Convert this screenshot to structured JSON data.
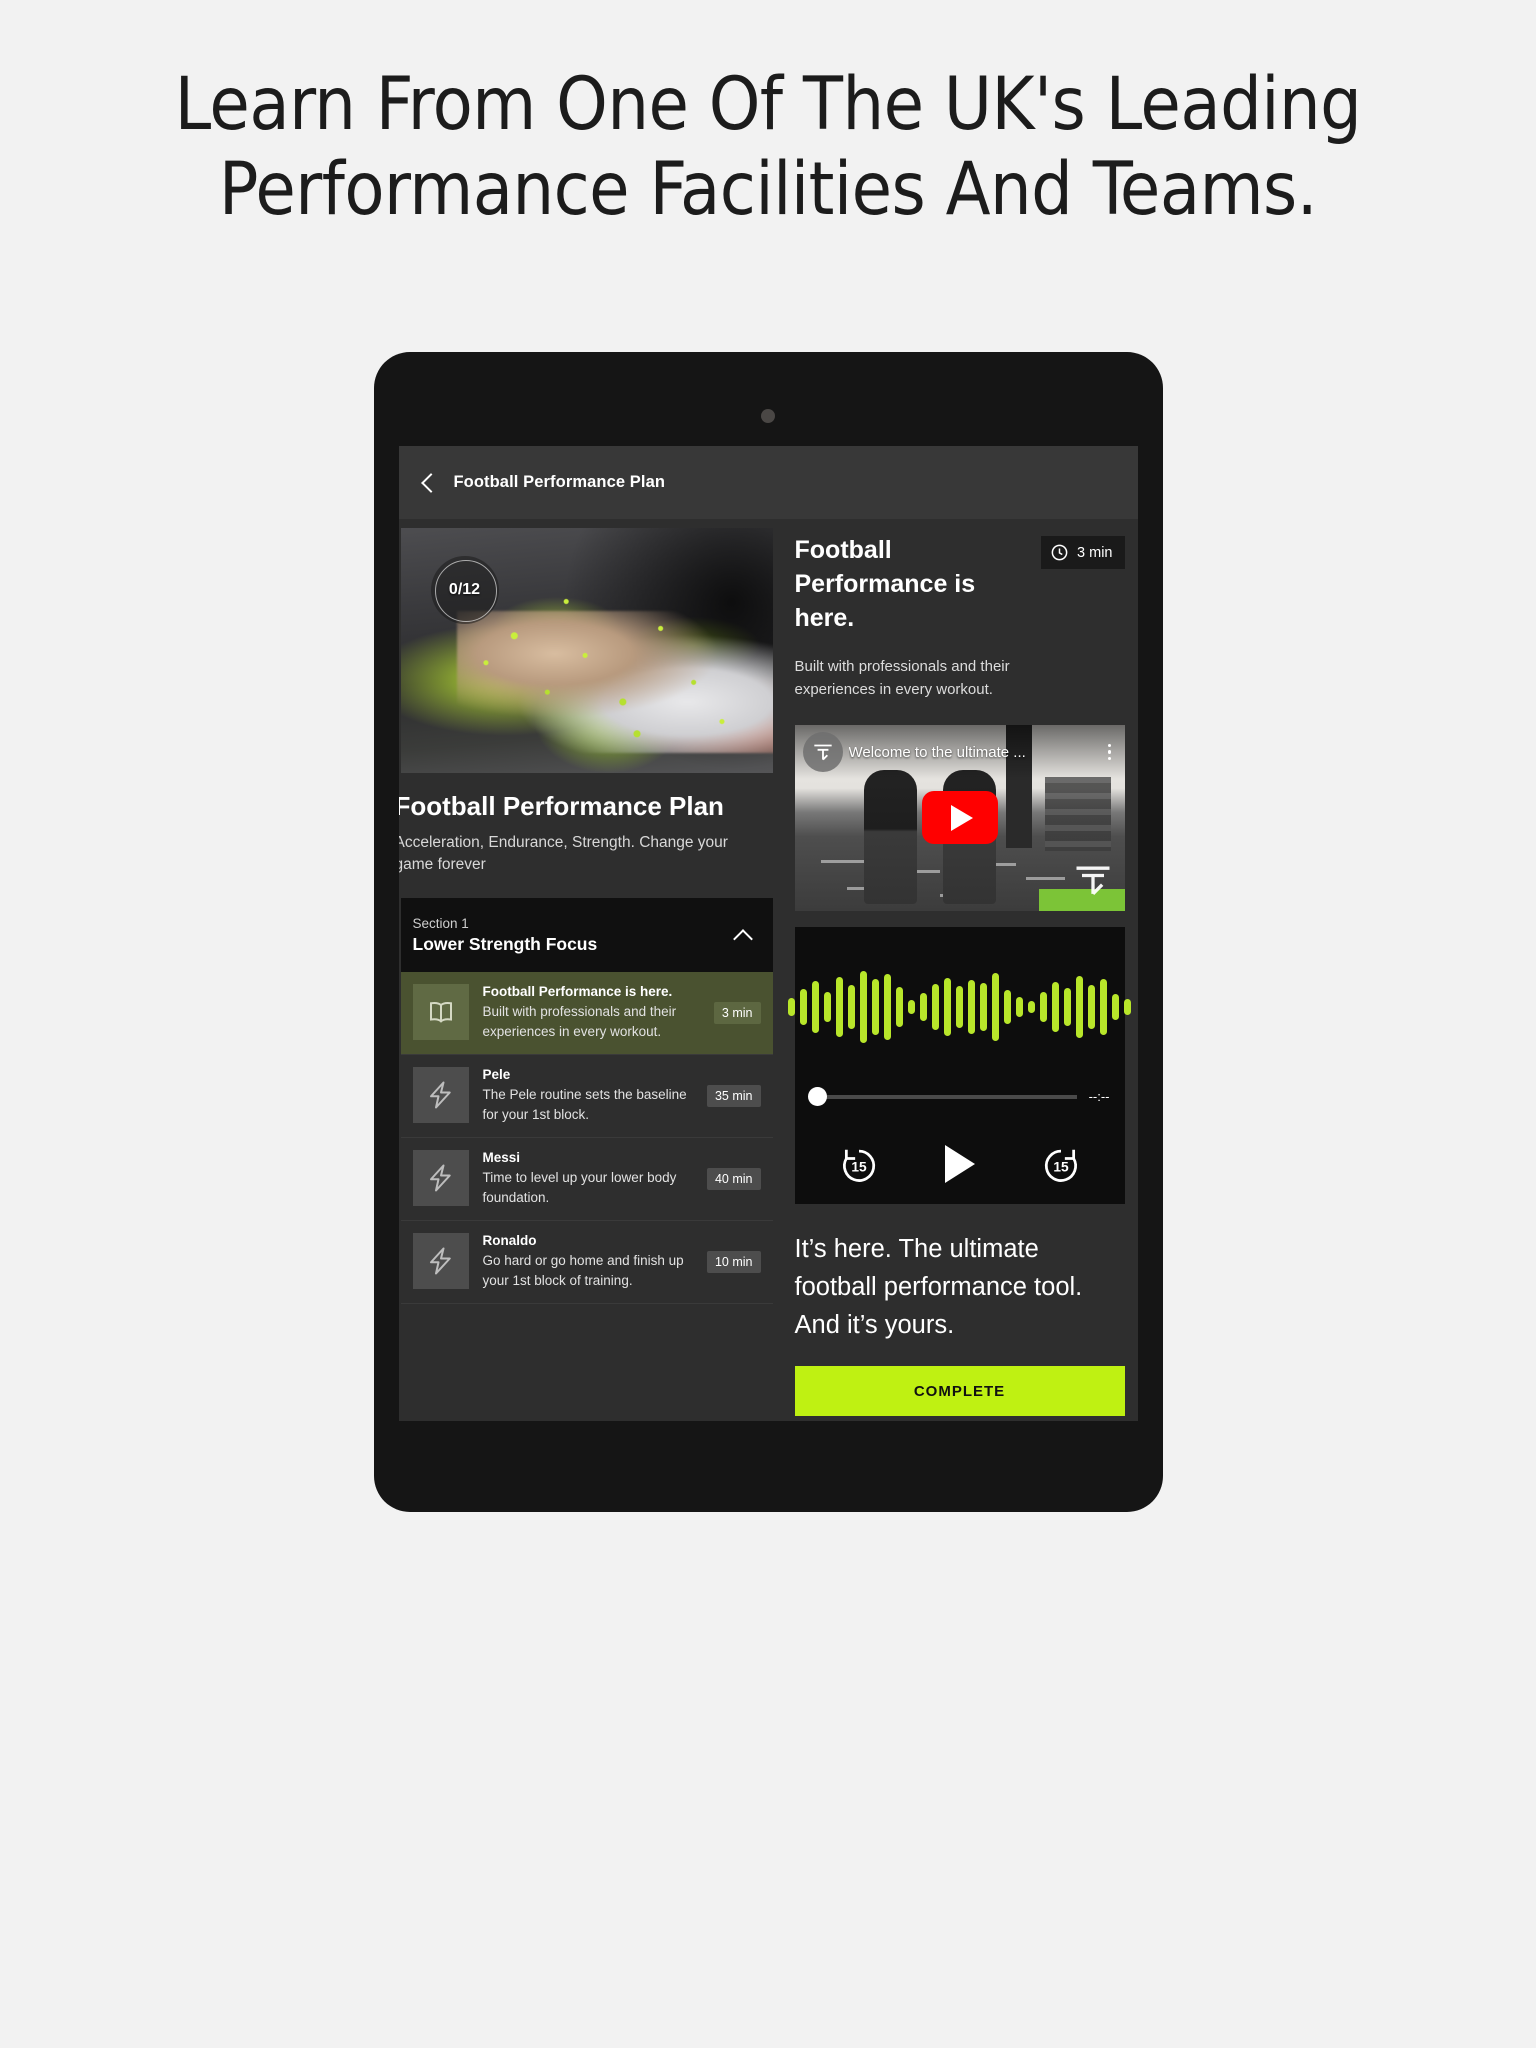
{
  "headline": "Learn From One Of The UK's Leading Performance Facilities And Teams.",
  "appbar": {
    "title": "Football Performance Plan",
    "back_icon": "chevron-left-icon"
  },
  "course": {
    "progress": "0/12",
    "title": "Football Performance Plan",
    "subtitle": "Acceleration, Endurance, Strength. Change your game forever"
  },
  "section": {
    "label": "Section 1",
    "name": "Lower Strength Focus",
    "collapse_icon": "chevron-up-icon"
  },
  "lessons": [
    {
      "title": "Football Performance is here.",
      "desc": "Built with professionals and their experiences in every workout.",
      "duration": "3 min",
      "icon": "book-icon",
      "active": true
    },
    {
      "title": "Pele",
      "desc": "The Pele routine sets the baseline for your 1st block.",
      "duration": "35 min",
      "icon": "lightning-icon",
      "active": false
    },
    {
      "title": "Messi",
      "desc": "Time to level up your lower body foundation.",
      "duration": "40 min",
      "icon": "lightning-icon",
      "active": false
    },
    {
      "title": "Ronaldo",
      "desc": "Go hard or go home and finish up your 1st block of training.",
      "duration": "10 min",
      "icon": "lightning-icon",
      "active": false
    }
  ],
  "detail": {
    "title": "Football Performance is here.",
    "duration": "3 min",
    "clock_icon": "clock-icon",
    "blurb": "Built with professionals and their experiences in every workout.",
    "final_copy": "It’s here. The ultimate football performance tool. And it’s yours.",
    "cta_label": "COMPLETE"
  },
  "video": {
    "title": "Welcome to the ultimate ...",
    "play_icon": "youtube-play-icon",
    "menu_icon": "kebab-menu-icon",
    "avatar_icon": "titan-performance-logo-icon",
    "watermark_icon": "titan-performance-watermark-icon"
  },
  "audio": {
    "elapsed": "--:--",
    "rewind_label": "15",
    "forward_label": "15",
    "play_icon": "play-icon",
    "rewind_icon": "replay-15-icon",
    "forward_icon": "forward-15-icon",
    "waveform": [
      18,
      36,
      52,
      30,
      60,
      44,
      72,
      56,
      66,
      40,
      14,
      28,
      46,
      58,
      42,
      54,
      48,
      68,
      34,
      20,
      12,
      30,
      50,
      38,
      62,
      44,
      56,
      26,
      16
    ]
  },
  "colors": {
    "accent": "#bff112",
    "waveform": "#b8e62a",
    "active_row": "#4a5230",
    "youtube_red": "#ff0000",
    "page_bg": "#f2f2f2"
  }
}
